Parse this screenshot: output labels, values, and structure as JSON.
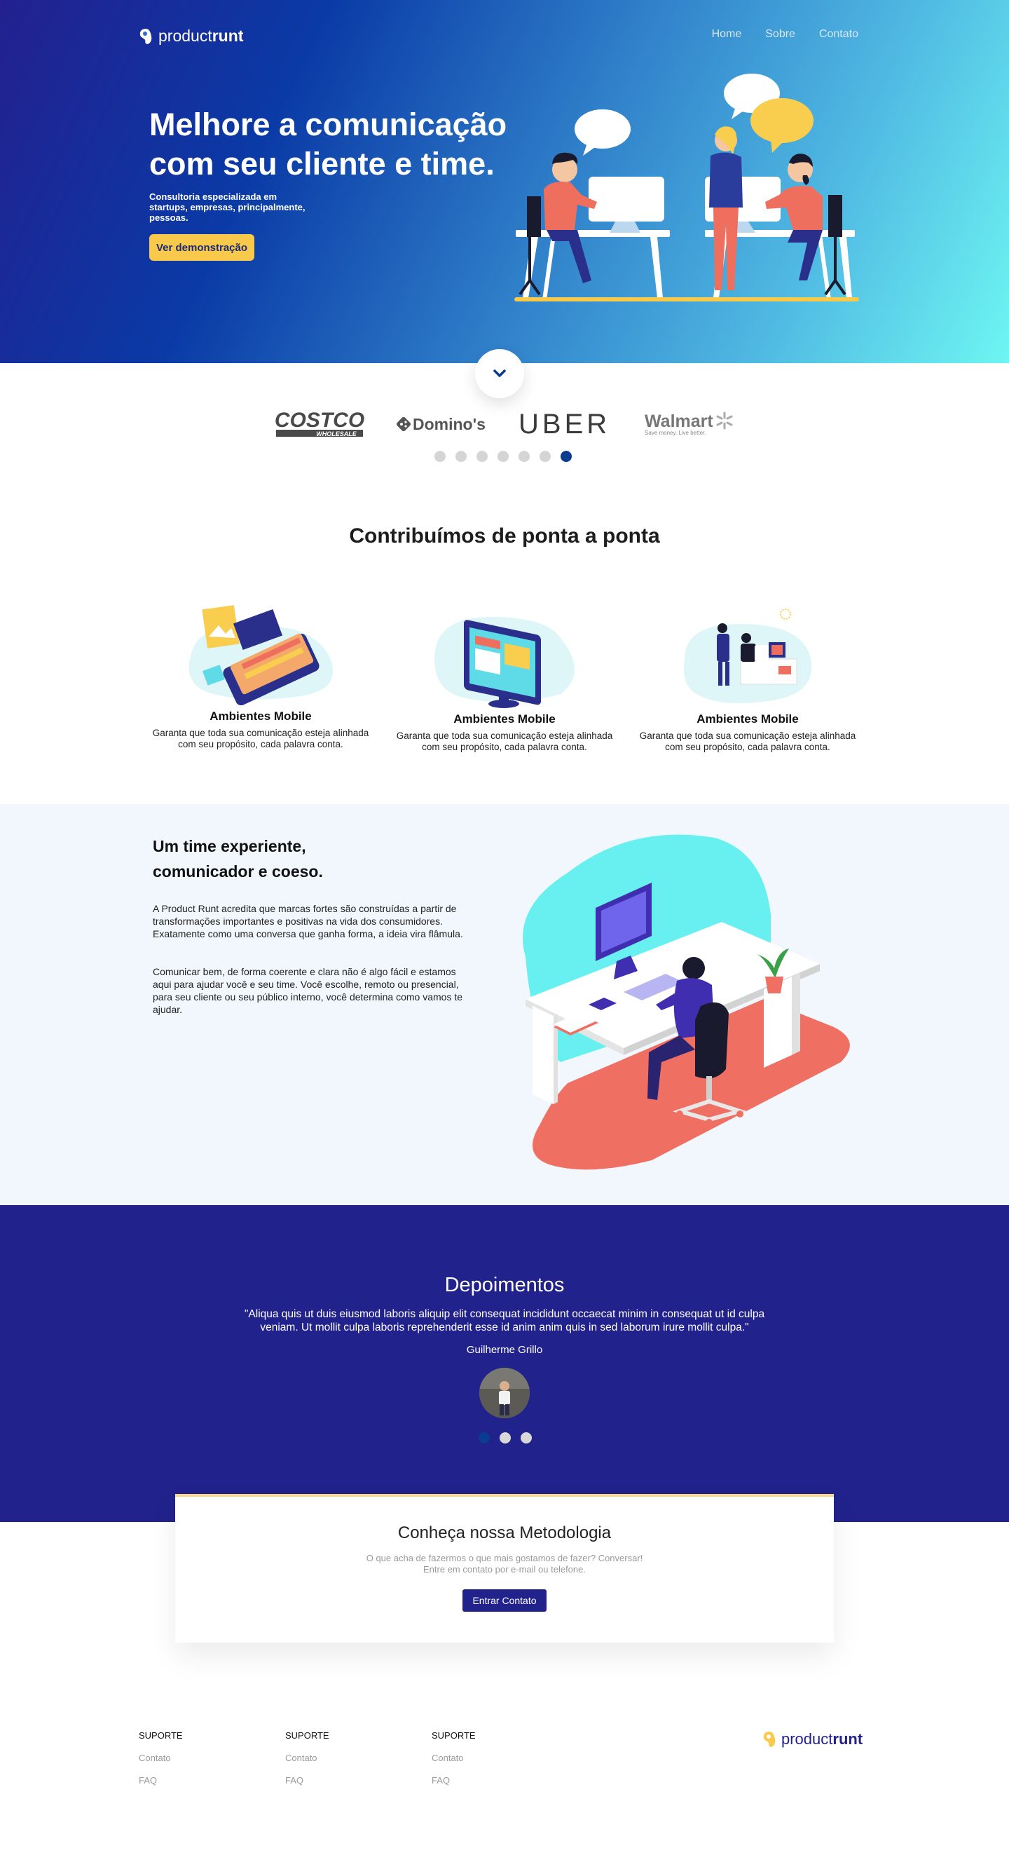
{
  "header": {
    "logo_light": "product",
    "logo_bold": "runt",
    "nav": [
      "Home",
      "Sobre",
      "Contato"
    ]
  },
  "hero": {
    "title": "Melhore a comunicação com seu cliente e time.",
    "subtitle": "Consultoria especializada em startups, empresas, principalmente, pessoas.",
    "cta": "Ver demonstração"
  },
  "clients": {
    "logos": [
      "COSTCO",
      "WHOLESALE",
      "Domino's",
      "UBER",
      "Walmart",
      "Save money. Live better."
    ],
    "active_dot": 7,
    "dot_count": 7
  },
  "features": {
    "title": "Contribuímos de ponta a ponta",
    "items": [
      {
        "title": "Ambientes Mobile",
        "text": "Garanta que toda sua comunicação esteja alinhada com seu propósito, cada palavra conta.",
        "icon": "mobile-illustration"
      },
      {
        "title": "Ambientes Mobile",
        "text": "Garanta que toda sua comunicação esteja alinhada com seu propósito, cada palavra conta.",
        "icon": "monitor-illustration"
      },
      {
        "title": "Ambientes Mobile",
        "text": "Garanta que toda sua comunicação esteja alinhada com seu propósito, cada palavra conta.",
        "icon": "office-team-illustration"
      }
    ]
  },
  "team": {
    "title": "Um time experiente, comunicador e coeso.",
    "p1": "A Product Runt acredita que marcas fortes são construídas a partir de transformações importantes e positivas na vida dos consumidores. Exatamente como uma conversa que ganha forma, a ideia vira flâmula.",
    "p2": "Comunicar bem, de forma coerente e clara não é algo fácil e estamos aqui para ajudar você e seu time. Você escolhe, remoto ou presencial, para seu cliente ou seu público interno, você determina como vamos te ajudar."
  },
  "testimonials": {
    "title": "Depoimentos",
    "quote": "\"Aliqua quis ut duis eiusmod laboris aliquip elit consequat incididunt occaecat minim in consequat ut id culpa veniam. Ut mollit culpa laboris reprehenderit esse id anim anim quis in sed laborum irure mollit culpa.\"",
    "author": "Guilherme Grillo",
    "active_dot": 1,
    "dot_count": 3
  },
  "cta": {
    "title": "Conheça nossa Metodologia",
    "line1": "O que acha de fazermos o que mais gostamos de fazer? Conversar!",
    "line2": "Entre em contato por e-mail ou telefone.",
    "button": "Entrar Contato"
  },
  "footer": {
    "columns": [
      {
        "title": "SUPORTE",
        "links": [
          "Contato",
          "FAQ"
        ]
      },
      {
        "title": "SUPORTE",
        "links": [
          "Contato",
          "FAQ"
        ]
      },
      {
        "title": "SUPORTE",
        "links": [
          "Contato",
          "FAQ"
        ]
      }
    ],
    "logo_light": "product",
    "logo_bold": "runt"
  },
  "colors": {
    "brand_navy": "#22228c",
    "accent_yellow": "#f8c94a",
    "hero_gradient_start": "#23208f",
    "hero_gradient_end": "#6ef6f2",
    "coral": "#ef7062"
  }
}
